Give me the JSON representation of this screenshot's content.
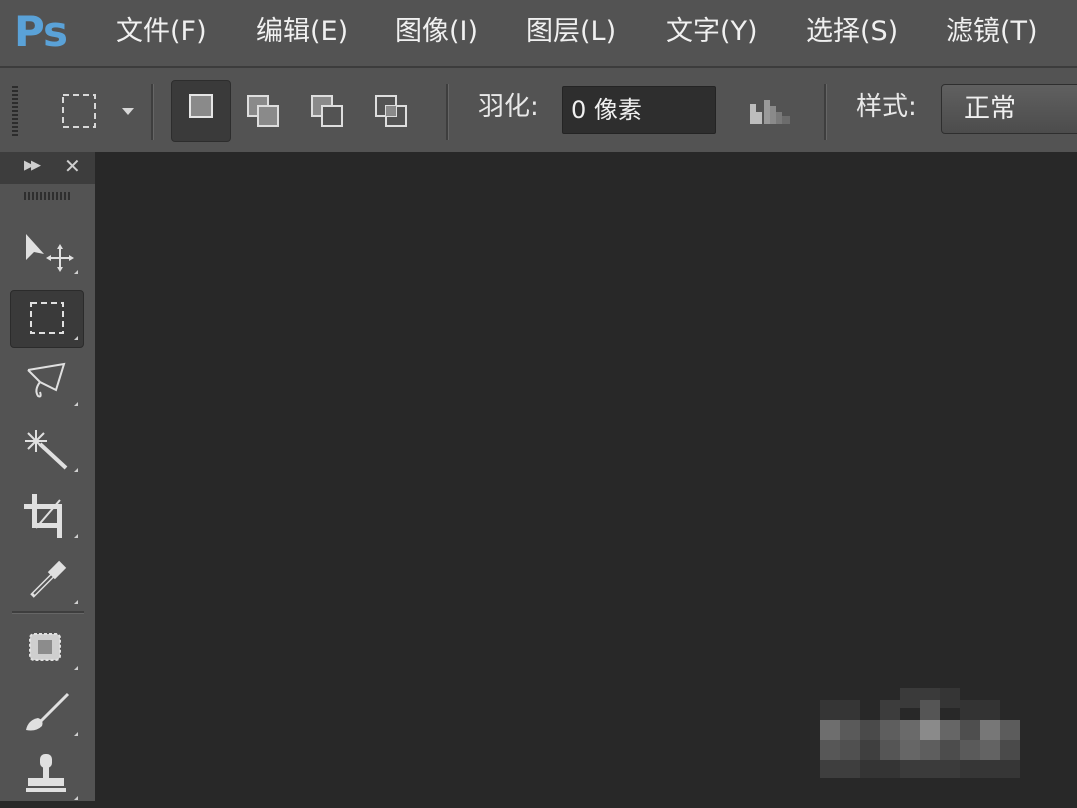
{
  "app": {
    "logo": "Ps"
  },
  "menu": {
    "items": [
      {
        "label": "文件(F)"
      },
      {
        "label": "编辑(E)"
      },
      {
        "label": "图像(I)"
      },
      {
        "label": "图层(L)"
      },
      {
        "label": "文字(Y)"
      },
      {
        "label": "选择(S)"
      },
      {
        "label": "滤镜(T)"
      }
    ]
  },
  "options": {
    "feather_label": "羽化:",
    "feather_value": "0 像素",
    "style_label": "样式:",
    "style_value": "正常",
    "selection_modes": [
      "new-selection",
      "add-to-selection",
      "subtract-from-selection",
      "intersect-with-selection"
    ]
  },
  "tools": [
    {
      "name": "move-tool",
      "icon": "move-icon"
    },
    {
      "name": "rectangular-marquee-tool",
      "icon": "marquee-icon",
      "active": true
    },
    {
      "name": "polygonal-lasso-tool",
      "icon": "lasso-icon"
    },
    {
      "name": "magic-wand-tool",
      "icon": "magic-wand-icon"
    },
    {
      "name": "crop-tool",
      "icon": "crop-icon"
    },
    {
      "name": "eyedropper-tool",
      "icon": "eyedropper-icon"
    },
    {
      "name": "spot-healing-brush-tool",
      "icon": "bandage-icon"
    },
    {
      "name": "brush-tool",
      "icon": "brush-icon"
    },
    {
      "name": "clone-stamp-tool",
      "icon": "stamp-icon"
    }
  ],
  "colors": {
    "ui_gray": "#535353",
    "canvas": "#282828",
    "logo_blue": "#5aa2d8"
  }
}
